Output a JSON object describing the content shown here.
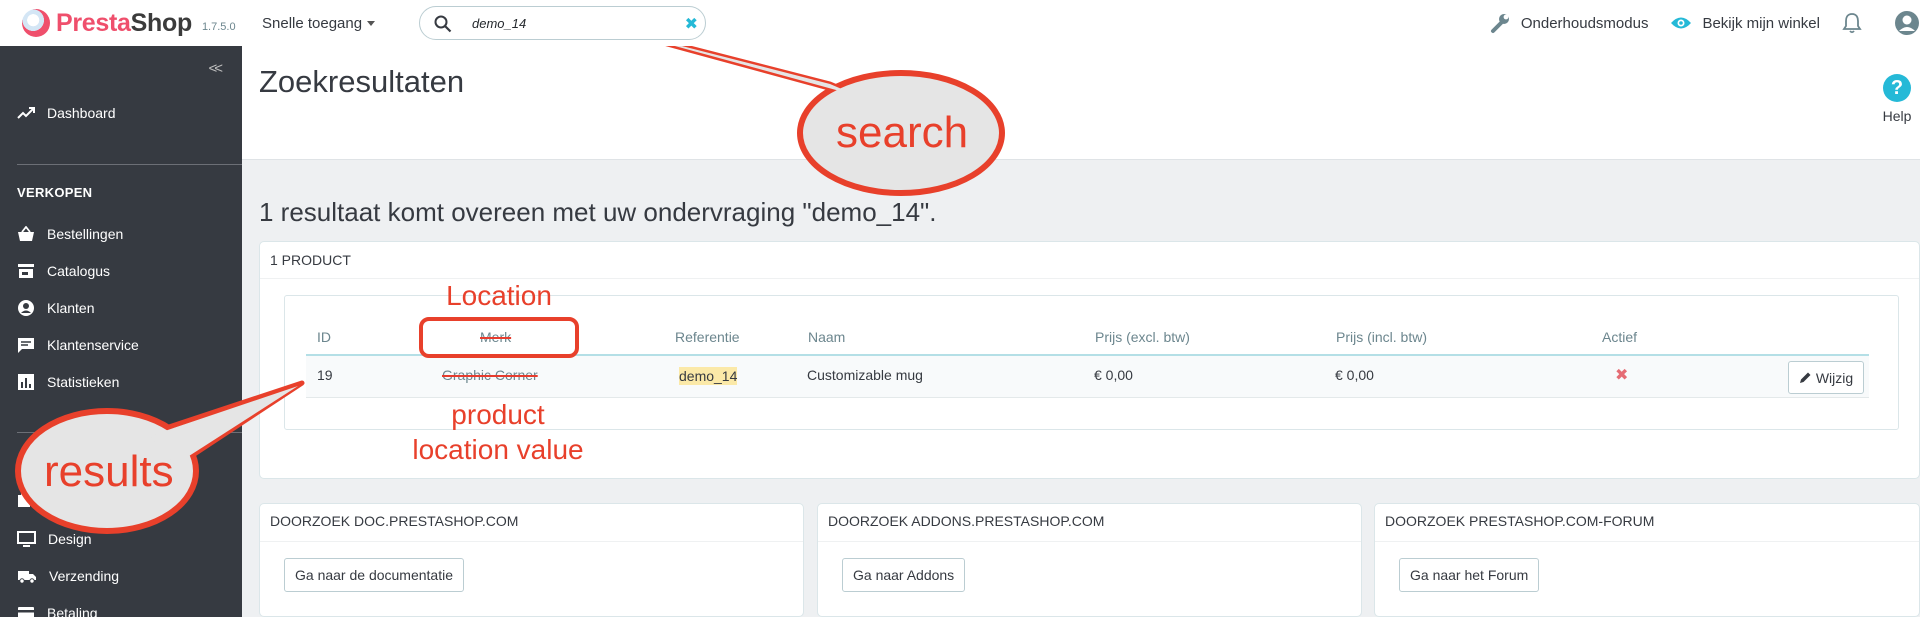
{
  "header": {
    "brand_first": "Presta",
    "brand_second": "Shop",
    "version": "1.7.5.0",
    "quick_access": "Snelle toegang",
    "search_value": "demo_14",
    "maintenance": "Onderhoudsmodus",
    "view_shop": "Bekijk mijn winkel"
  },
  "sidebar": {
    "collapse": "<<",
    "dashboard": "Dashboard",
    "section_sell": "VERKOPEN",
    "items": [
      {
        "label": "Bestellingen",
        "icon": "basket-icon"
      },
      {
        "label": "Catalogus",
        "icon": "store-icon"
      },
      {
        "label": "Klanten",
        "icon": "account-circle-icon"
      },
      {
        "label": "Klantenservice",
        "icon": "chat-icon"
      },
      {
        "label": "Statistieken",
        "icon": "bar-chart-icon"
      }
    ],
    "lower_items": [
      {
        "label": "Design",
        "icon": "desktop-icon"
      },
      {
        "label": "Verzending",
        "icon": "truck-icon"
      },
      {
        "label": "Betaling",
        "icon": "credit-card-icon"
      }
    ]
  },
  "page": {
    "title": "Zoekresultaten",
    "help_label": "Help",
    "help_glyph": "?",
    "result_heading": "1 resultaat komt overeen met uw ondervraging \"demo_14\"."
  },
  "products_panel": {
    "heading": "1 PRODUCT",
    "columns": [
      "ID",
      "Merk",
      "Referentie",
      "Naam",
      "Prijs (excl. btw)",
      "Prijs (incl. btw)",
      "Actief"
    ],
    "row": {
      "id": "19",
      "brand": "Graphic Corner",
      "reference": "demo_14",
      "name": "Customizable mug",
      "price_excl": "€ 0,00",
      "price_incl": "€ 0,00",
      "active_glyph": "✖",
      "edit_label": "Wijzig"
    }
  },
  "search_panels": [
    {
      "heading": "DOORZOEK DOC.PRESTASHOP.COM",
      "button": "Ga naar de documentatie"
    },
    {
      "heading": "DOORZOEK ADDONS.PRESTASHOP.COM",
      "button": "Ga naar Addons"
    },
    {
      "heading": "DOORZOEK PRESTASHOP.COM-FORUM",
      "button": "Ga naar het Forum"
    }
  ],
  "annotations": {
    "search_bubble": "search",
    "results_bubble": "results",
    "location_label": "Location",
    "product_label_1": "product",
    "product_label_2": "location value"
  },
  "colors": {
    "annotation_red": "#e8402b",
    "brand_pink": "#ef4f6c",
    "accent_blue": "#25b9d7",
    "sidebar_bg": "#363a41"
  }
}
